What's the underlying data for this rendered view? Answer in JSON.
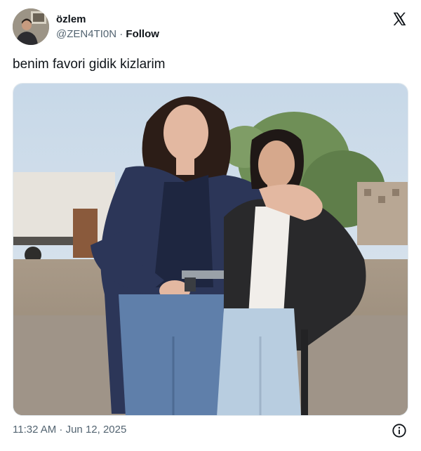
{
  "author": {
    "display_name": "özlem",
    "handle": "@ZEN4TI0N",
    "separator": "·",
    "follow_label": "Follow"
  },
  "tweet": {
    "text": "benim favori gidik kizlarim"
  },
  "footer": {
    "timestamp": "11:32 AM · Jun 12, 2025"
  },
  "icons": {
    "brand": "x-logo-icon",
    "info": "info-icon"
  },
  "colors": {
    "text_primary": "#0f1419",
    "text_secondary": "#536471",
    "border": "#e1e8ed"
  }
}
